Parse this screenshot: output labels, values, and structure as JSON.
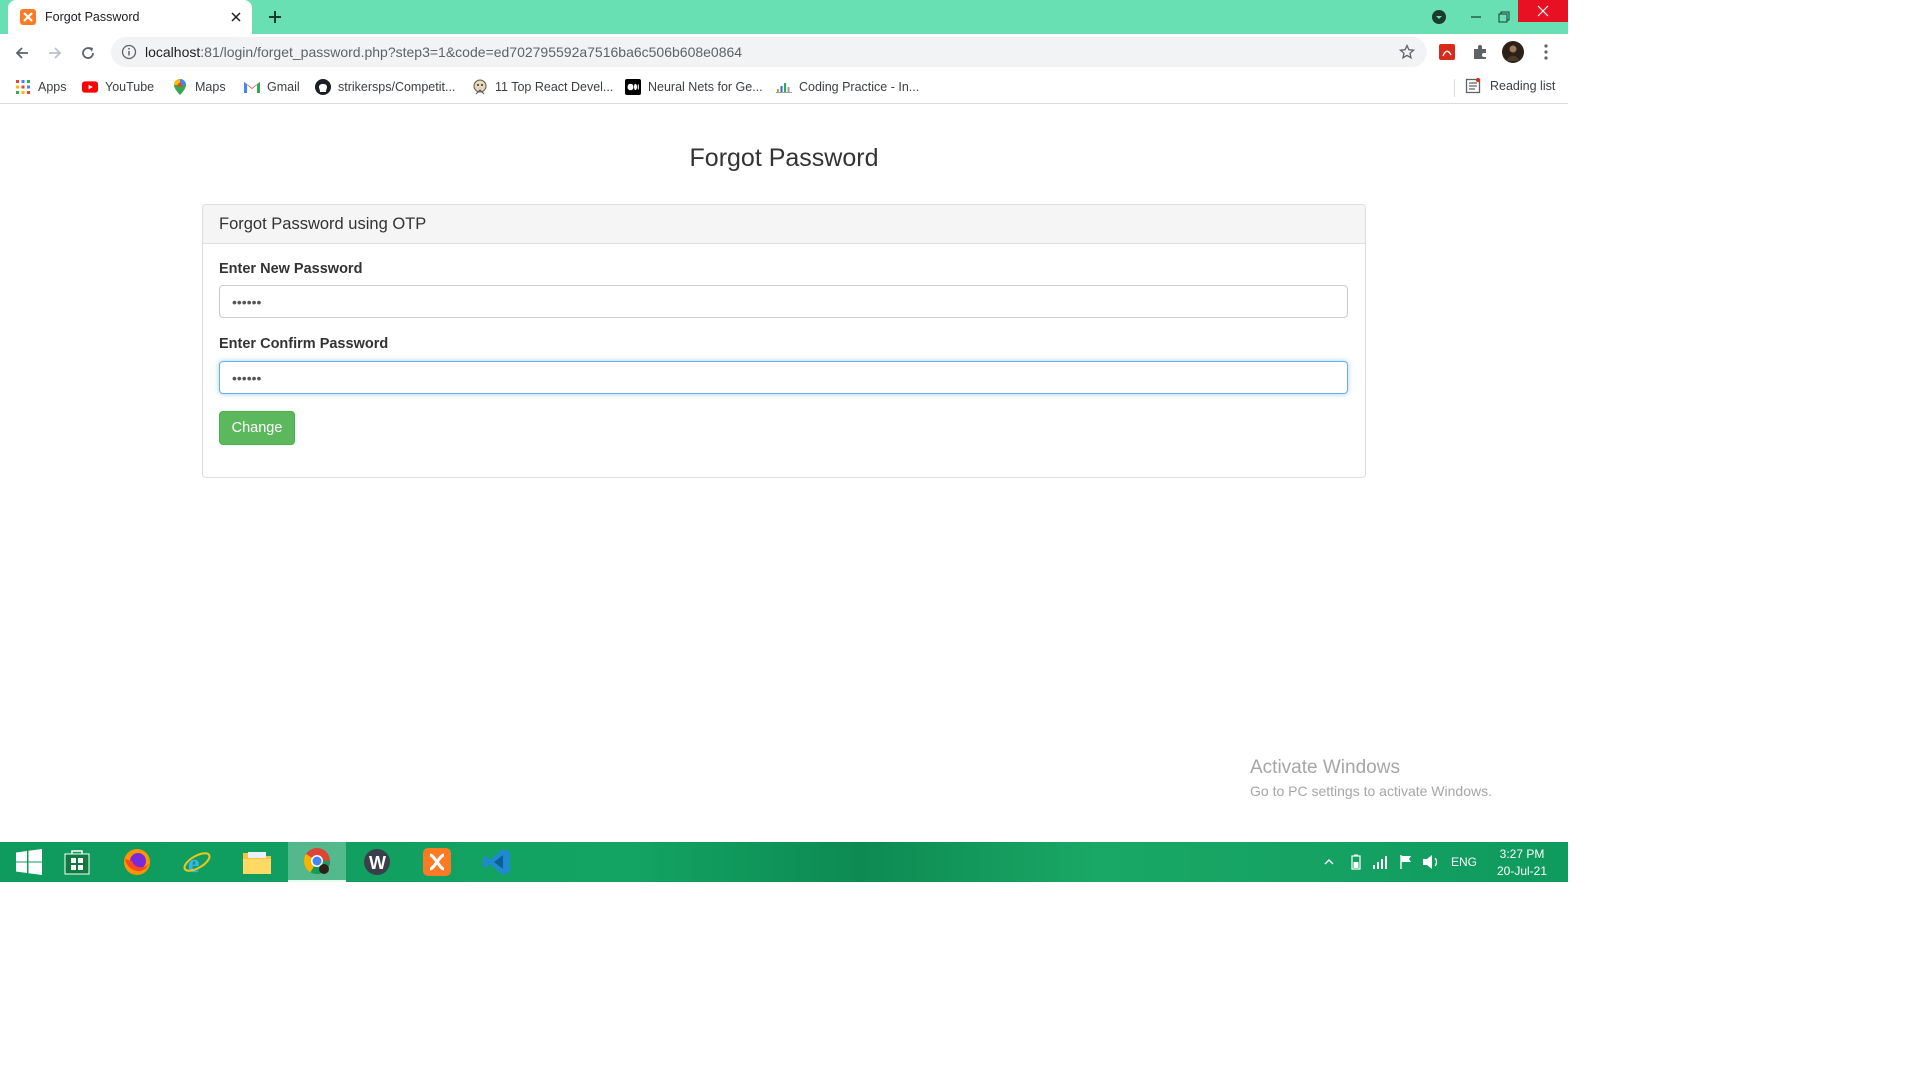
{
  "browser": {
    "tab_title": "Forgot Password",
    "url_host": "localhost",
    "url_rest": ":81/login/forget_password.php?step3=1&code=ed702795592a7516ba6c506b608e0864",
    "bookmarks": [
      {
        "label": "Apps",
        "icon": "apps-grid-icon"
      },
      {
        "label": "YouTube",
        "icon": "youtube-icon"
      },
      {
        "label": "Maps",
        "icon": "maps-pin-icon"
      },
      {
        "label": "Gmail",
        "icon": "gmail-icon"
      },
      {
        "label": "strikersps/Competit...",
        "icon": "github-icon"
      },
      {
        "label": "11 Top React Devel...",
        "icon": "site-icon"
      },
      {
        "label": "Neural Nets for Ge...",
        "icon": "medium-icon"
      },
      {
        "label": "Coding Practice - In...",
        "icon": "chart-icon"
      }
    ],
    "reading_list": "Reading list"
  },
  "page": {
    "title": "Forgot Password",
    "panel_heading": "Forgot Password using OTP",
    "new_password_label": "Enter New Password",
    "new_password_value": "••••••",
    "confirm_password_label": "Enter Confirm Password",
    "confirm_password_value": "••••••",
    "change_button": "Change"
  },
  "watermark": {
    "line1": "Activate Windows",
    "line2": "Go to PC settings to activate Windows."
  },
  "taskbar": {
    "language": "ENG",
    "time": "3:27 PM",
    "date": "20-Jul-21"
  },
  "colors": {
    "tabstrip": "#68e0b4",
    "button_green": "#5cb85c",
    "focus_blue": "#66afe9"
  }
}
